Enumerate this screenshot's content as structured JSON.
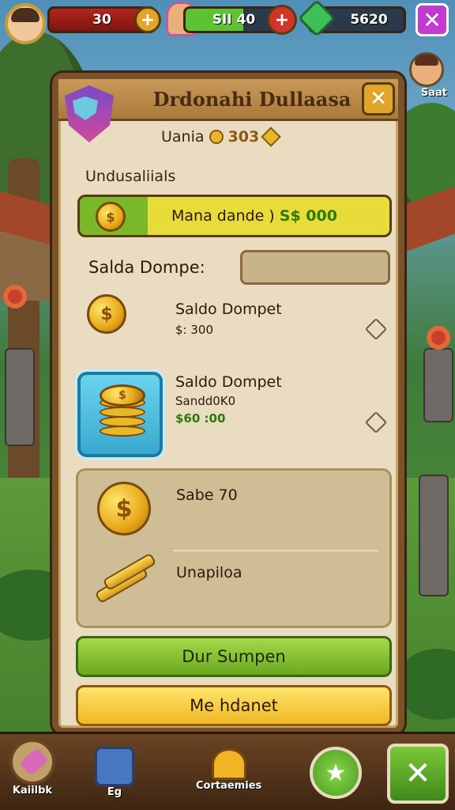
{
  "hud": {
    "health_value": "30",
    "energy_value": "SII 40",
    "gem_value": "5620"
  },
  "panel": {
    "title": "Drdonahi Dullaasa",
    "subheader_text": "Uania",
    "subheader_value": "303",
    "section_label": "Undusaliials",
    "balance_bar_text": "Mana dande )",
    "balance_bar_value": "S$ 000",
    "search_label": "Salda Dompe:",
    "items": [
      {
        "title": "Saldo Dompet",
        "subtitle": "$: 300"
      },
      {
        "title": "Saldo Dompet",
        "subtitle": "Sandd0K0",
        "value": "$60 :00"
      },
      {
        "title": "Sabe 70"
      },
      {
        "title": "Unapiloa"
      }
    ],
    "primary_button": "Dur Sumpen",
    "secondary_button": "Me hdanet"
  },
  "side": {
    "label": "Saat"
  },
  "bottom_nav": [
    {
      "label": "Kaiilbk"
    },
    {
      "label": "Eg"
    },
    {
      "label": "Cortaemies"
    }
  ],
  "colors": {
    "panel_bg": "#e9dcc0",
    "panel_border": "#7a5228",
    "accent_green": "#6aa820",
    "accent_yellow": "#f0b824",
    "close_magenta": "#c23ad2"
  }
}
